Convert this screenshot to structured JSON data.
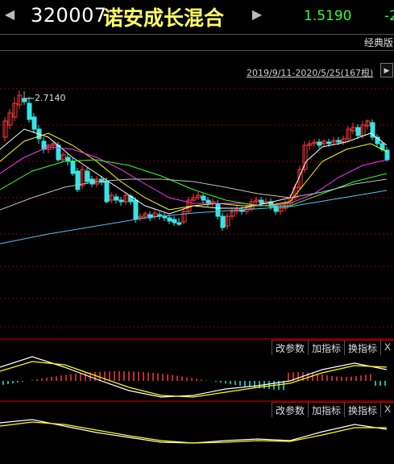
{
  "header": {
    "prev_arrow": "◀",
    "next_arrow": "▶",
    "fund_code": "320007",
    "fund_name": "诺安成长混合",
    "price": "1.5190",
    "change": "-2"
  },
  "subbar": {
    "style_button": "经典版"
  },
  "chart": {
    "range_text": "2019/9/11-2020/5/25(167根)",
    "range_button": "▶",
    "max_label": "2.7140"
  },
  "indicator_panels": [
    {
      "tools": [
        "改参数",
        "加指标",
        "换指标",
        "X"
      ]
    },
    {
      "tools": [
        "改参数",
        "加指标",
        "换指标",
        "X"
      ]
    }
  ],
  "colors": {
    "up": "#ff3b3b",
    "down": "#33e6e6",
    "ma5": "#ffffff",
    "ma10": "#ffff00",
    "ma20": "#ff33ff",
    "ma30": "#33ff33",
    "ma60": "#c0c0c0",
    "ma120": "#4fc3f7"
  }
}
